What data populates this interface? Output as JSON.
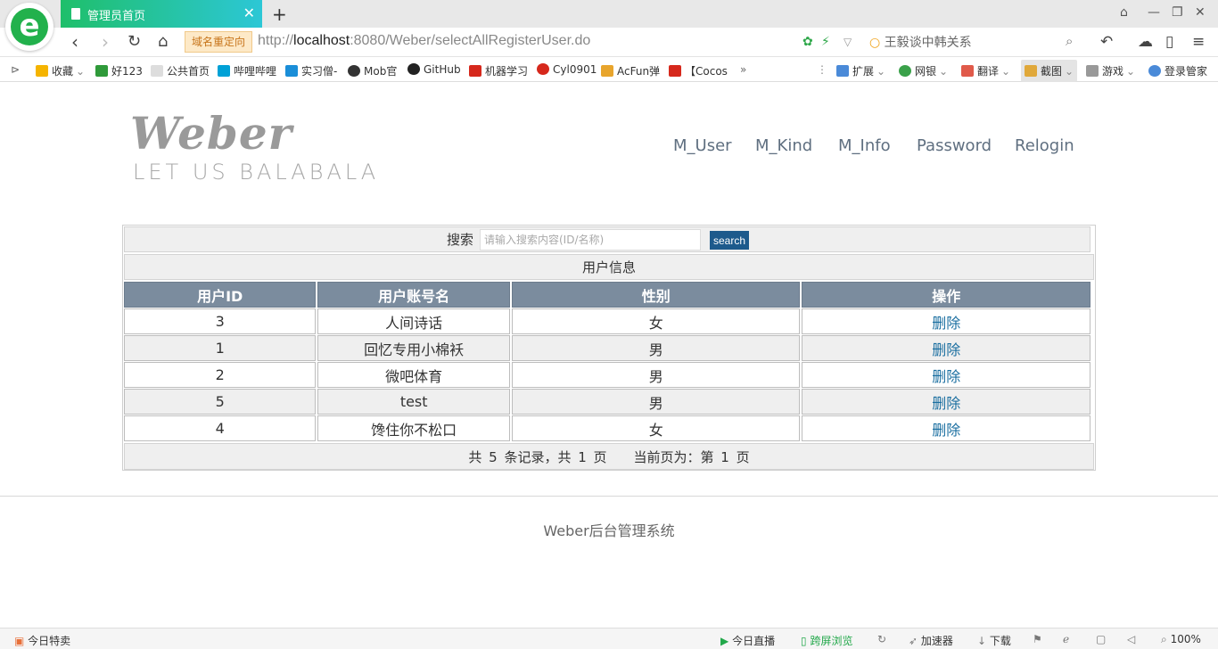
{
  "browser": {
    "tab_title": "管理员首页",
    "tab_close": "✕",
    "new_tab": "+",
    "logo_letter": "e",
    "redirect_label": "域名重定向",
    "url_prefix": "http://",
    "url_host": "localhost",
    "url_rest": ":8080/Weber/selectAllRegisterUser.do",
    "search_hint": "王毅谈中韩关系",
    "bookmarks": [
      {
        "label": "收藏",
        "color": "#f5b400"
      },
      {
        "label": "好123",
        "color": "#2f9a3a"
      },
      {
        "label": "公共首页",
        "color": "#bdbdbd"
      },
      {
        "label": "哔哩哔哩",
        "color": "#00a1d6"
      },
      {
        "label": "实习僧-",
        "color": "#1a8ed8"
      },
      {
        "label": "Mob官",
        "color": "#333333"
      },
      {
        "label": "GitHub",
        "color": "#222222"
      },
      {
        "label": "机器学习",
        "color": "#d6281c"
      },
      {
        "label": "Cyl0901",
        "color": "#d6281c"
      },
      {
        "label": "AcFun弹",
        "color": "#e8a52c"
      },
      {
        "label": "【Cocos",
        "color": "#d6281c"
      }
    ],
    "more": "»",
    "tools": [
      {
        "label": "扩展",
        "color": "#4a8ad8"
      },
      {
        "label": "网银",
        "color": "#3aa14a"
      },
      {
        "label": "翻译",
        "color": "#e05a4a"
      },
      {
        "label": "截图",
        "color": "#e0a83a"
      },
      {
        "label": "游戏",
        "color": "#888888"
      },
      {
        "label": "登录管家",
        "color": "#4a8ad8"
      }
    ],
    "status_left": "今日特卖",
    "status_live": "今日直播",
    "status_cross": "跨屏浏览",
    "status_accel": "加速器",
    "status_download": "下载",
    "zoom": "100%"
  },
  "site": {
    "brand": "Weber",
    "tagline": "LET US BALABALA",
    "nav": [
      "M_User",
      "M_Kind",
      "M_Info",
      "Password",
      "Relogin"
    ],
    "search_label": "搜索",
    "search_placeholder": "请输入搜索内容(ID/名称)",
    "search_button": "search",
    "table_caption": "用户信息",
    "columns": [
      "用户ID",
      "用户账号名",
      "性别",
      "操作"
    ],
    "rows": [
      {
        "id": "3",
        "name": "人间诗话",
        "gender": "女",
        "action": "删除"
      },
      {
        "id": "1",
        "name": "回忆专用小棉袄",
        "gender": "男",
        "action": "删除"
      },
      {
        "id": "2",
        "name": "微吧体育",
        "gender": "男",
        "action": "删除"
      },
      {
        "id": "5",
        "name": "test",
        "gender": "男",
        "action": "删除"
      },
      {
        "id": "4",
        "name": "馋住你不松口",
        "gender": "女",
        "action": "删除"
      }
    ],
    "pager": "共 5 条记录，共 1 页　　当前页为：第 1 页",
    "footer": "Weber后台管理系统"
  }
}
